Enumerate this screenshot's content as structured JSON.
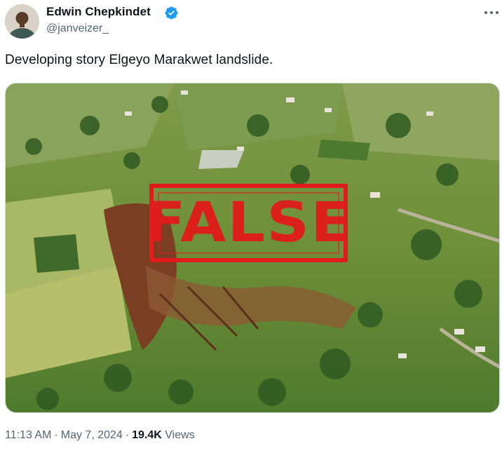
{
  "author": {
    "display_name": "Edwin Chepkindet",
    "handle": "@janveizer_",
    "verified": true,
    "verified_color": "#1d9bf0"
  },
  "tweet": {
    "text": "Developing story Elgeyo Marakwet landslide.",
    "image_stamp": "FALSE",
    "stamp_color": "#e11b1b"
  },
  "meta": {
    "time": "11:13 AM",
    "date": "May 7, 2024",
    "views_count": "19.4K",
    "views_label": "Views"
  },
  "icons": {
    "more": "more-horizontal-icon",
    "verified": "verified-badge-icon"
  }
}
